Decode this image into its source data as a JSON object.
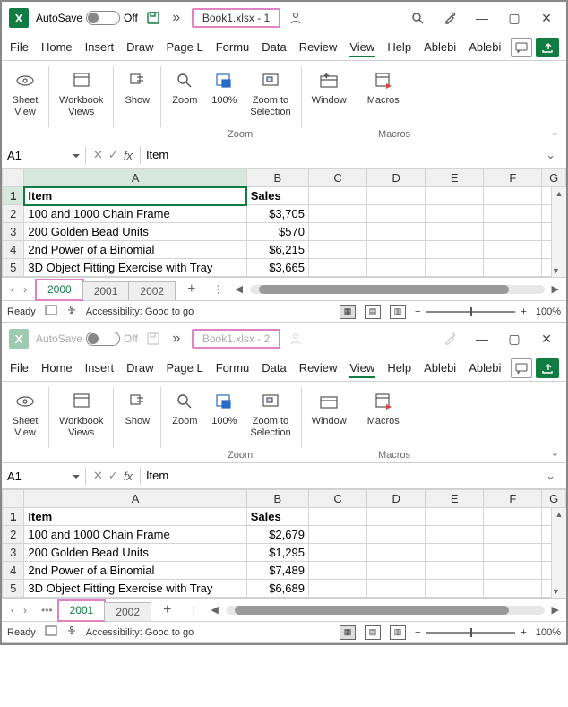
{
  "w1": {
    "title": "Book1.xlsx  -  1",
    "autosave": "AutoSave",
    "autosave_state": "Off",
    "menu": [
      "File",
      "Home",
      "Insert",
      "Draw",
      "Page L",
      "Formu",
      "Data",
      "Review",
      "View",
      "Help",
      "Ablebi",
      "Ablebi"
    ],
    "active_menu": 8,
    "ribbon": {
      "sheet_view": "Sheet\nView",
      "workbook_views": "Workbook\nViews",
      "show": "Show",
      "zoom": "Zoom",
      "pct100": "100%",
      "zoom_sel": "Zoom to\nSelection",
      "window": "Window",
      "macros": "Macros",
      "g_zoom": "Zoom",
      "g_macros": "Macros"
    },
    "namebox": "A1",
    "formula": "Item",
    "cols": [
      "A",
      "B",
      "C",
      "D",
      "E",
      "F",
      "G"
    ],
    "rows": [
      {
        "n": "1",
        "item": "Item",
        "sales": "Sales",
        "hdr": true
      },
      {
        "n": "2",
        "item": "100 and 1000 Chain Frame",
        "sales": "$3,705"
      },
      {
        "n": "3",
        "item": "200 Golden Bead Units",
        "sales": "$570"
      },
      {
        "n": "4",
        "item": "2nd Power of a Binomial",
        "sales": "$6,215"
      },
      {
        "n": "5",
        "item": "3D Object Fitting Exercise with Tray",
        "sales": "$3,665"
      }
    ],
    "tabs": [
      "2000",
      "2001",
      "2002"
    ],
    "active_tab": 0,
    "status_ready": "Ready",
    "status_acc": "Accessibility: Good to go",
    "zoom": "100%"
  },
  "w2": {
    "title": "Book1.xlsx  -  2",
    "autosave": "AutoSave",
    "autosave_state": "Off",
    "menu": [
      "File",
      "Home",
      "Insert",
      "Draw",
      "Page L",
      "Formu",
      "Data",
      "Review",
      "View",
      "Help",
      "Ablebi",
      "Ablebi"
    ],
    "active_menu": 8,
    "ribbon": {
      "sheet_view": "Sheet\nView",
      "workbook_views": "Workbook\nViews",
      "show": "Show",
      "zoom": "Zoom",
      "pct100": "100%",
      "zoom_sel": "Zoom to\nSelection",
      "window": "Window",
      "macros": "Macros",
      "g_zoom": "Zoom",
      "g_macros": "Macros"
    },
    "namebox": "A1",
    "formula": "Item",
    "cols": [
      "A",
      "B",
      "C",
      "D",
      "E",
      "F",
      "G"
    ],
    "rows": [
      {
        "n": "1",
        "item": "Item",
        "sales": "Sales",
        "hdr": true
      },
      {
        "n": "2",
        "item": "100 and 1000 Chain Frame",
        "sales": "$2,679"
      },
      {
        "n": "3",
        "item": "200 Golden Bead Units",
        "sales": "$1,295"
      },
      {
        "n": "4",
        "item": "2nd Power of a Binomial",
        "sales": "$7,489"
      },
      {
        "n": "5",
        "item": "3D Object Fitting Exercise with Tray",
        "sales": "$6,689"
      }
    ],
    "tabs": [
      "2001",
      "2002"
    ],
    "active_tab": 0,
    "status_ready": "Ready",
    "status_acc": "Accessibility: Good to go",
    "zoom": "100%"
  },
  "chart_data": {
    "type": "table",
    "tables": [
      {
        "name": "2000",
        "columns": [
          "Item",
          "Sales"
        ],
        "rows": [
          [
            "100 and 1000 Chain Frame",
            3705
          ],
          [
            "200 Golden Bead Units",
            570
          ],
          [
            "2nd Power of a Binomial",
            6215
          ],
          [
            "3D Object Fitting Exercise with Tray",
            3665
          ]
        ]
      },
      {
        "name": "2001",
        "columns": [
          "Item",
          "Sales"
        ],
        "rows": [
          [
            "100 and 1000 Chain Frame",
            2679
          ],
          [
            "200 Golden Bead Units",
            1295
          ],
          [
            "2nd Power of a Binomial",
            7489
          ],
          [
            "3D Object Fitting Exercise with Tray",
            6689
          ]
        ]
      }
    ]
  }
}
